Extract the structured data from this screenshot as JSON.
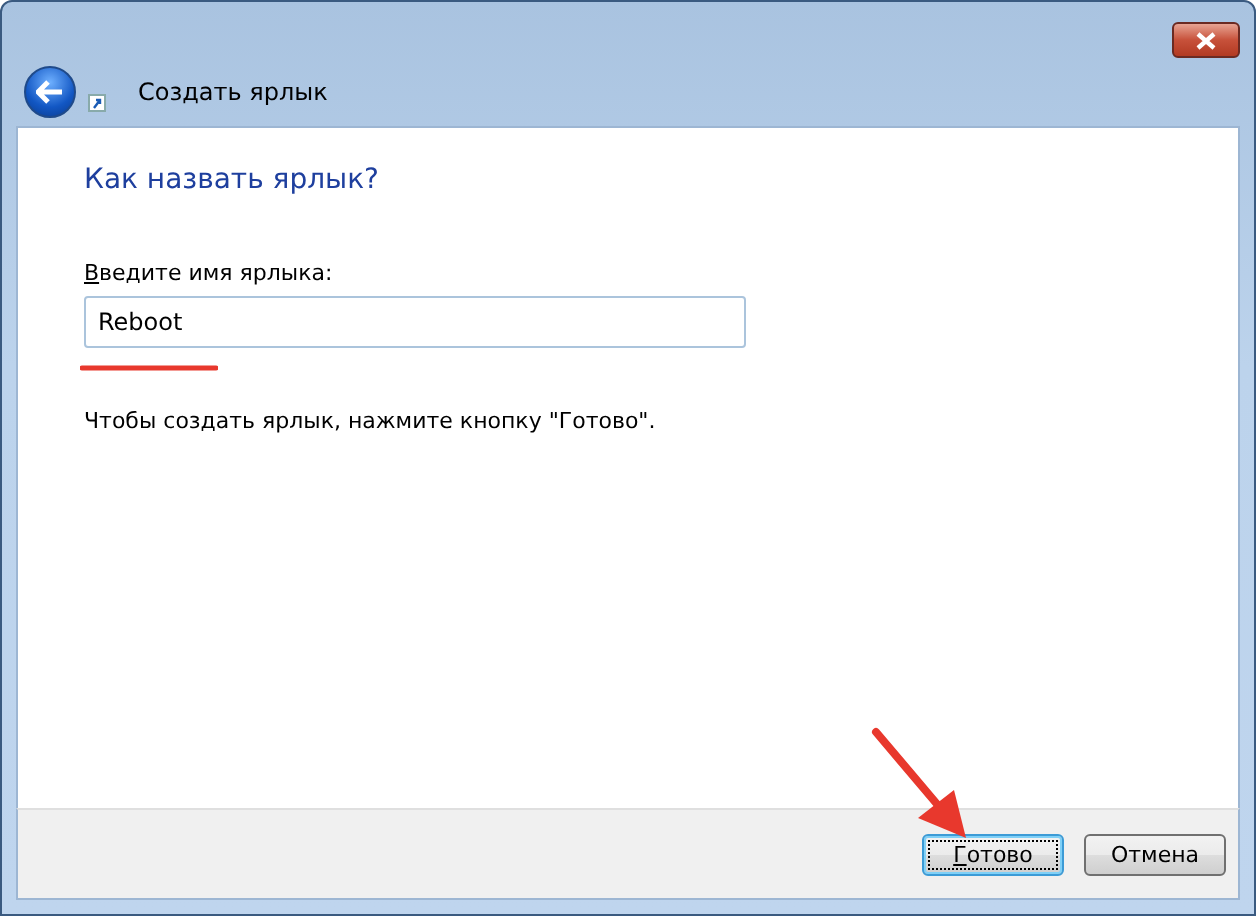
{
  "window": {
    "title": "Создать ярлык"
  },
  "heading": "Как назвать ярлык?",
  "name_field": {
    "label": "Введите имя ярлыка:",
    "value": "Reboot"
  },
  "hint": "Чтобы создать ярлык, нажмите кнопку \"Готово\".",
  "buttons": [
    {
      "label": "Готово",
      "default": true
    },
    {
      "label": "Отмена",
      "default": false
    }
  ]
}
